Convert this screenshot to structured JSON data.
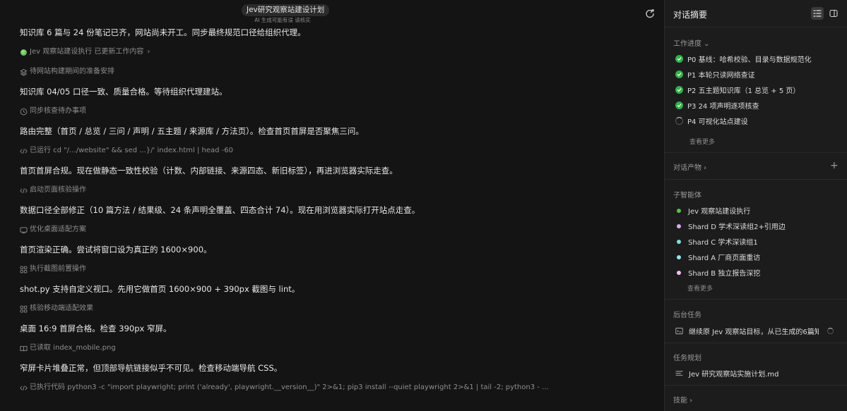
{
  "header": {
    "title": "Jev研究观察站建设计划",
    "ai_note": "AI 生成可能有误 请核实"
  },
  "feed": [
    {
      "kind": "msg",
      "text": "知识库 6 篇与 24 份笔记已齐，网站尚未开工。同步最终规范口径给组织代理。"
    },
    {
      "kind": "step",
      "icon": "green-dot-icon",
      "text": "Jev 观察站建设执行 已更新工作内容",
      "chevron": true
    },
    {
      "kind": "step",
      "icon": "layers-icon",
      "text": "待网站构建期间的准备安排"
    },
    {
      "kind": "msg",
      "text": "知识库 04/05 口径一致、质量合格。等待组织代理建站。"
    },
    {
      "kind": "step",
      "icon": "clock-icon",
      "text": "同步核查待办事项"
    },
    {
      "kind": "msg",
      "text": "路由完整（首页 / 总览 / 三问 / 声明 / 五主题 / 来源库 / 方法页）。检查首页首屏是否聚焦三问。"
    },
    {
      "kind": "step",
      "icon": "code-icon",
      "text": "已运行 cd \"/.../website\" && sed ...}/' index.html | head -60"
    },
    {
      "kind": "msg",
      "text": "首页首屏合规。现在做静态一致性校验（计数、内部链接、来源四态、新旧标签），再进浏览器实际走查。"
    },
    {
      "kind": "step",
      "icon": "code-icon",
      "text": "启动页面核验操作"
    },
    {
      "kind": "msg",
      "text": "数据口径全部修正（10 篇方法 / 结果级、24 条声明全覆盖、四态合计 74）。现在用浏览器实际打开站点走查。"
    },
    {
      "kind": "step",
      "icon": "monitor-icon",
      "text": "优化桌面适配方案"
    },
    {
      "kind": "msg",
      "text": "首页渲染正确。尝试将窗口设为真正的 1600×900。"
    },
    {
      "kind": "step",
      "icon": "grid-icon",
      "text": "执行截图前置操作"
    },
    {
      "kind": "msg",
      "text": "shot.py 支持自定义视口。先用它做首页 1600×900 + 390px 截图与 lint。"
    },
    {
      "kind": "step",
      "icon": "grid-icon",
      "text": "核验移动端适配效果"
    },
    {
      "kind": "msg",
      "text": "桌面 16:9 首屏合格。检查 390px 窄屏。"
    },
    {
      "kind": "step",
      "icon": "book-icon",
      "text": "已读取 index_mobile.png"
    },
    {
      "kind": "msg",
      "text": "窄屏卡片堆叠正常，但顶部导航链接似乎不可见。检查移动端导航 CSS。"
    },
    {
      "kind": "step",
      "icon": "code-icon",
      "text": "已执行代码 python3 -c \"import playwright; print ('already', playwright.__version__)\" 2>&1; pip3 install --quiet playwright 2>&1 | tail -2; python3 - ..."
    }
  ],
  "panel": {
    "title": "对话摘要",
    "progress": {
      "title": "工作进度",
      "items": [
        {
          "label": "P0 基线：哈希校验、目录与数据规范化",
          "status": "done"
        },
        {
          "label": "P1 本轮只读网络查证",
          "status": "done"
        },
        {
          "label": "P2 五主题知识库（1 总览 + 5 页）",
          "status": "done"
        },
        {
          "label": "P3 24 项声明逐项核查",
          "status": "done"
        },
        {
          "label": "P4 可视化站点建设",
          "status": "running"
        }
      ],
      "more": "查看更多"
    },
    "artifacts": {
      "title": "对话产物"
    },
    "agents": {
      "title": "子智能体",
      "items": [
        {
          "label": "Jev 观察站建设执行",
          "color": "#57c24a"
        },
        {
          "label": "Shard D 学术深读组2+引用边",
          "color": "#e0a8f0"
        },
        {
          "label": "Shard C 学术深读组1",
          "color": "#7fe0d8"
        },
        {
          "label": "Shard A 厂商页面重访",
          "color": "#8fe8f0"
        },
        {
          "label": "Shard B 独立报告深挖",
          "color": "#f0c0f0"
        }
      ],
      "more": "查看更多"
    },
    "background": {
      "title": "后台任务",
      "item": "继续原 Jev 观察站目标，从已生成的6篇知识"
    },
    "plan": {
      "title": "任务规划",
      "item": "Jev 研究观察站实施计划.md"
    },
    "skills": {
      "title": "技能"
    }
  }
}
